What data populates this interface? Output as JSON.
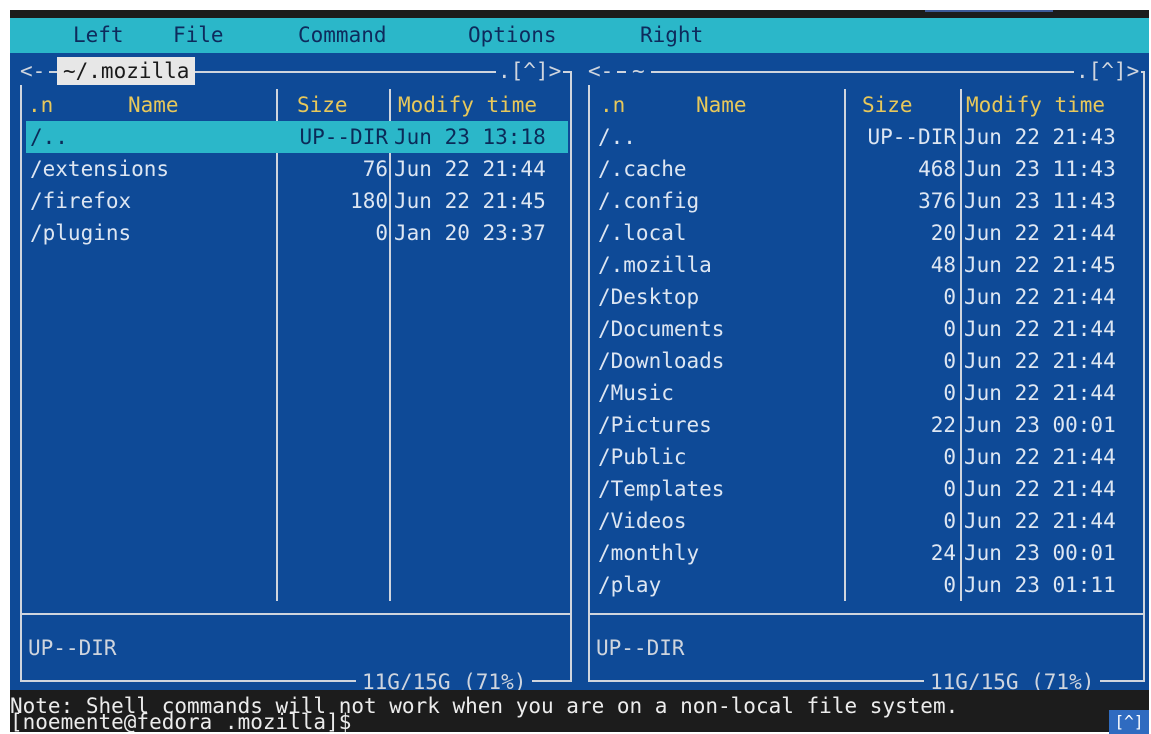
{
  "menu": {
    "left": "Left",
    "file": "File",
    "command": "Command",
    "options": "Options",
    "right": "Right"
  },
  "columns": {
    "n": ".n",
    "name": "Name",
    "size": "Size",
    "modify": "Modify time"
  },
  "left_panel": {
    "corner_left": "<-",
    "path": "~/.mozilla",
    "corner_right": ".[^]>",
    "rows": [
      {
        "name": "/..",
        "size": "UP--DIR",
        "mtime": "Jun 23 13:18",
        "selected": true
      },
      {
        "name": "/extensions",
        "size": "76",
        "mtime": "Jun 22 21:44"
      },
      {
        "name": "/firefox",
        "size": "180",
        "mtime": "Jun 22 21:45"
      },
      {
        "name": "/plugins",
        "size": "0",
        "mtime": "Jan 20 23:37"
      }
    ],
    "mini_status": "UP--DIR",
    "disk": "11G/15G (71%)"
  },
  "right_panel": {
    "corner_left": "<-",
    "path": "~",
    "corner_right": ".[^]>",
    "rows": [
      {
        "name": "/..",
        "size": "UP--DIR",
        "mtime": "Jun 22 21:43"
      },
      {
        "name": "/.cache",
        "size": "468",
        "mtime": "Jun 23 11:43"
      },
      {
        "name": "/.config",
        "size": "376",
        "mtime": "Jun 23 11:43"
      },
      {
        "name": "/.local",
        "size": "20",
        "mtime": "Jun 22 21:44"
      },
      {
        "name": "/.mozilla",
        "size": "48",
        "mtime": "Jun 22 21:45"
      },
      {
        "name": "/Desktop",
        "size": "0",
        "mtime": "Jun 22 21:44"
      },
      {
        "name": "/Documents",
        "size": "0",
        "mtime": "Jun 22 21:44"
      },
      {
        "name": "/Downloads",
        "size": "0",
        "mtime": "Jun 22 21:44"
      },
      {
        "name": "/Music",
        "size": "0",
        "mtime": "Jun 22 21:44"
      },
      {
        "name": "/Pictures",
        "size": "22",
        "mtime": "Jun 23 00:01"
      },
      {
        "name": "/Public",
        "size": "0",
        "mtime": "Jun 22 21:44"
      },
      {
        "name": "/Templates",
        "size": "0",
        "mtime": "Jun 22 21:44"
      },
      {
        "name": "/Videos",
        "size": "0",
        "mtime": "Jun 22 21:44"
      },
      {
        "name": "/monthly",
        "size": "24",
        "mtime": "Jun 23 00:01"
      },
      {
        "name": "/play",
        "size": "0",
        "mtime": "Jun 23 01:11"
      }
    ],
    "mini_status": "UP--DIR",
    "disk": "11G/15G (71%)"
  },
  "note": "Note: Shell commands will not work when you are on a non-local file system.",
  "prompt": "[noemente@fedora .mozilla]$",
  "prompt_badge": "[^]",
  "colors": {
    "panel_bg": "#0e4a97",
    "menu_bg": "#2bb7c9",
    "header_text": "#e8c85a",
    "selection_bg": "#2bb7c9",
    "terminal_bg": "#1c1c1c"
  }
}
